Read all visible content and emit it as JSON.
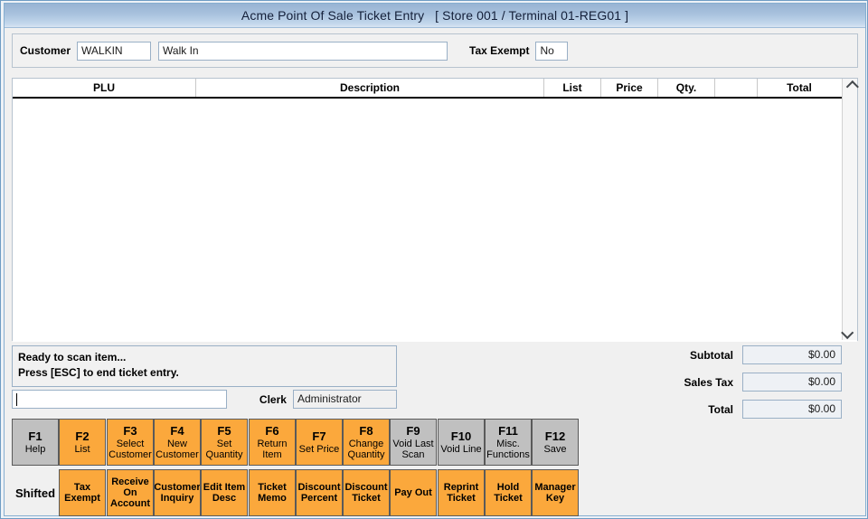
{
  "window": {
    "title": "Acme Point Of Sale Ticket Entry   [ Store 001 / Terminal 01-REG01 ]"
  },
  "customer": {
    "label": "Customer",
    "code": "WALKIN",
    "name": "Walk In",
    "tax_exempt_label": "Tax Exempt",
    "tax_exempt_value": "No"
  },
  "grid": {
    "columns": [
      {
        "key": "plu",
        "label": "PLU"
      },
      {
        "key": "description",
        "label": "Description"
      },
      {
        "key": "list",
        "label": "List"
      },
      {
        "key": "price",
        "label": "Price"
      },
      {
        "key": "qty",
        "label": "Qty."
      },
      {
        "key": "blank",
        "label": ""
      },
      {
        "key": "total",
        "label": "Total"
      }
    ],
    "rows": [],
    "scroll_up_icon": "chevron-up-icon",
    "scroll_down_icon": "chevron-down-icon"
  },
  "status": {
    "line1": "Ready to scan item...",
    "line2": "Press [ESC] to end ticket entry."
  },
  "scan": {
    "value": "",
    "clerk_label": "Clerk",
    "clerk_value": "Administrator"
  },
  "totals": {
    "subtotal_label": "Subtotal",
    "subtotal_value": "$0.00",
    "sales_tax_label": "Sales Tax",
    "sales_tax_value": "$0.00",
    "total_label": "Total",
    "total_value": "$0.00"
  },
  "fkeys": {
    "colors": {
      "enabled": "#fba83c",
      "disabled": "#c0c0c0"
    },
    "row": [
      {
        "num": "F1",
        "label": "Help",
        "enabled": false
      },
      {
        "num": "F2",
        "label": "List",
        "enabled": true
      },
      {
        "num": "F3",
        "label": "Select\nCustomer",
        "enabled": true
      },
      {
        "num": "F4",
        "label": "New\nCustomer",
        "enabled": true
      },
      {
        "num": "F5",
        "label": "Set\nQuantity",
        "enabled": true
      },
      {
        "num": "F6",
        "label": "Return\nItem",
        "enabled": true
      },
      {
        "num": "F7",
        "label": "Set Price",
        "enabled": true
      },
      {
        "num": "F8",
        "label": "Change\nQuantity",
        "enabled": true
      },
      {
        "num": "F9",
        "label": "Void Last\nScan",
        "enabled": false
      },
      {
        "num": "F10",
        "label": "Void Line",
        "enabled": false
      },
      {
        "num": "F11",
        "label": "Misc.\nFunctions",
        "enabled": false
      },
      {
        "num": "F12",
        "label": "Save",
        "enabled": false
      }
    ],
    "shifted_tag": "Shifted",
    "shifted": [
      {
        "label": "Tax Exempt",
        "enabled": true
      },
      {
        "label": "Receive\nOn\nAccount",
        "enabled": true
      },
      {
        "label": "Customer\nInquiry",
        "enabled": true
      },
      {
        "label": "Edit Item\nDesc",
        "enabled": true
      },
      {
        "label": "Ticket\nMemo",
        "enabled": true
      },
      {
        "label": "Discount\nPercent",
        "enabled": true
      },
      {
        "label": "Discount\nTicket",
        "enabled": true
      },
      {
        "label": "Pay Out",
        "enabled": true
      },
      {
        "label": "Reprint\nTicket",
        "enabled": true
      },
      {
        "label": "Hold\nTicket",
        "enabled": true
      },
      {
        "label": "Manager\nKey",
        "enabled": true
      }
    ]
  }
}
